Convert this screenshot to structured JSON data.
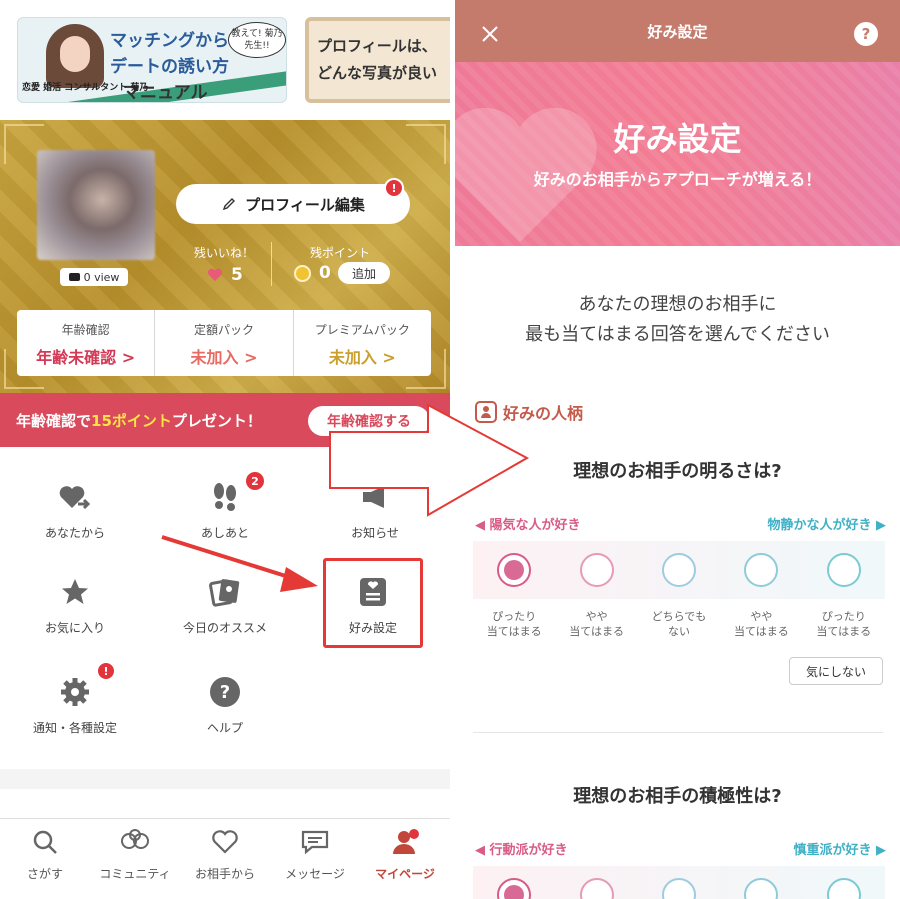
{
  "left": {
    "banner1": {
      "line1": "マッチングから",
      "line2": "デートの誘い方",
      "line3": "マニュアル",
      "bubble": "教えて! 菊乃先生!!",
      "name": "恋愛 婚活 コンサルタント 菊乃"
    },
    "banner2": {
      "line1": "プロフィールは、",
      "line2": "どんな写真が良い"
    },
    "profile": {
      "view_count": "0 view",
      "edit_label": "プロフィール編集",
      "edit_badge": "!",
      "likes_label": "残いいね！",
      "likes_value": "5",
      "points_label": "残ポイント",
      "points_value": "0",
      "add_label": "追加",
      "stats": [
        {
          "label": "年齢確認",
          "value": "年齢未確認 >",
          "color": "#d43a55"
        },
        {
          "label": "定額パック",
          "value": "未加入 >",
          "color": "#e76a63"
        },
        {
          "label": "プレミアムパック",
          "value": "未加入 >",
          "color": "#c9a02e"
        }
      ]
    },
    "promo": {
      "prefix": "年齢確認で",
      "highlight": "15ポイント",
      "suffix": "プレゼント！",
      "button": "年齢確認する"
    },
    "menu": [
      {
        "label": "あなたから",
        "icon": "heart-arrow-icon"
      },
      {
        "label": "あしあと",
        "icon": "footprints-icon",
        "badge": "2"
      },
      {
        "label": "お知らせ",
        "icon": "megaphone-icon"
      },
      {
        "label": "お気に入り",
        "icon": "star-icon"
      },
      {
        "label": "今日のオススメ",
        "icon": "photos-icon"
      },
      {
        "label": "好み設定",
        "icon": "preference-card-icon"
      },
      {
        "label": "通知・各種設定",
        "icon": "gear-icon",
        "badge": "!"
      },
      {
        "label": "ヘルプ",
        "icon": "help-icon"
      }
    ],
    "nav": [
      {
        "label": "さがす",
        "icon": "search-icon"
      },
      {
        "label": "コミュニティ",
        "icon": "community-icon"
      },
      {
        "label": "お相手から",
        "icon": "heart-outline-icon"
      },
      {
        "label": "メッセージ",
        "icon": "message-icon"
      },
      {
        "label": "マイページ",
        "icon": "person-icon",
        "active": true
      }
    ]
  },
  "right": {
    "header_title": "好み設定",
    "help": "?",
    "hero_title": "好み設定",
    "hero_subtitle": "好みのお相手からアプローチが増える！",
    "intro_line1": "あなたの理想のお相手に",
    "intro_line2": "最も当てはまる回答を選んでください",
    "section": "好みの人柄",
    "q1": {
      "title": "理想のお相手の明るさは?",
      "left": "◀ 陽気な人が好き",
      "right": "物静かな人が好き ▶"
    },
    "options": [
      {
        "l1": "ぴったり",
        "l2": "当てはまる"
      },
      {
        "l1": "やや",
        "l2": "当てはまる"
      },
      {
        "l1": "どちらでも",
        "l2": "ない"
      },
      {
        "l1": "やや",
        "l2": "当てはまる"
      },
      {
        "l1": "ぴったり",
        "l2": "当てはまる"
      }
    ],
    "dont_care": "気にしない",
    "q2": {
      "title": "理想のお相手の積極性は?",
      "left": "◀ 行動派が好き",
      "right": "慎重派が好き ▶"
    }
  },
  "colors": {
    "gold": "#c9a53f",
    "promo_red": "#d94a5c",
    "header": "#c57b6c",
    "hero_pink": "#f27d93",
    "accent_red": "#e53935"
  }
}
